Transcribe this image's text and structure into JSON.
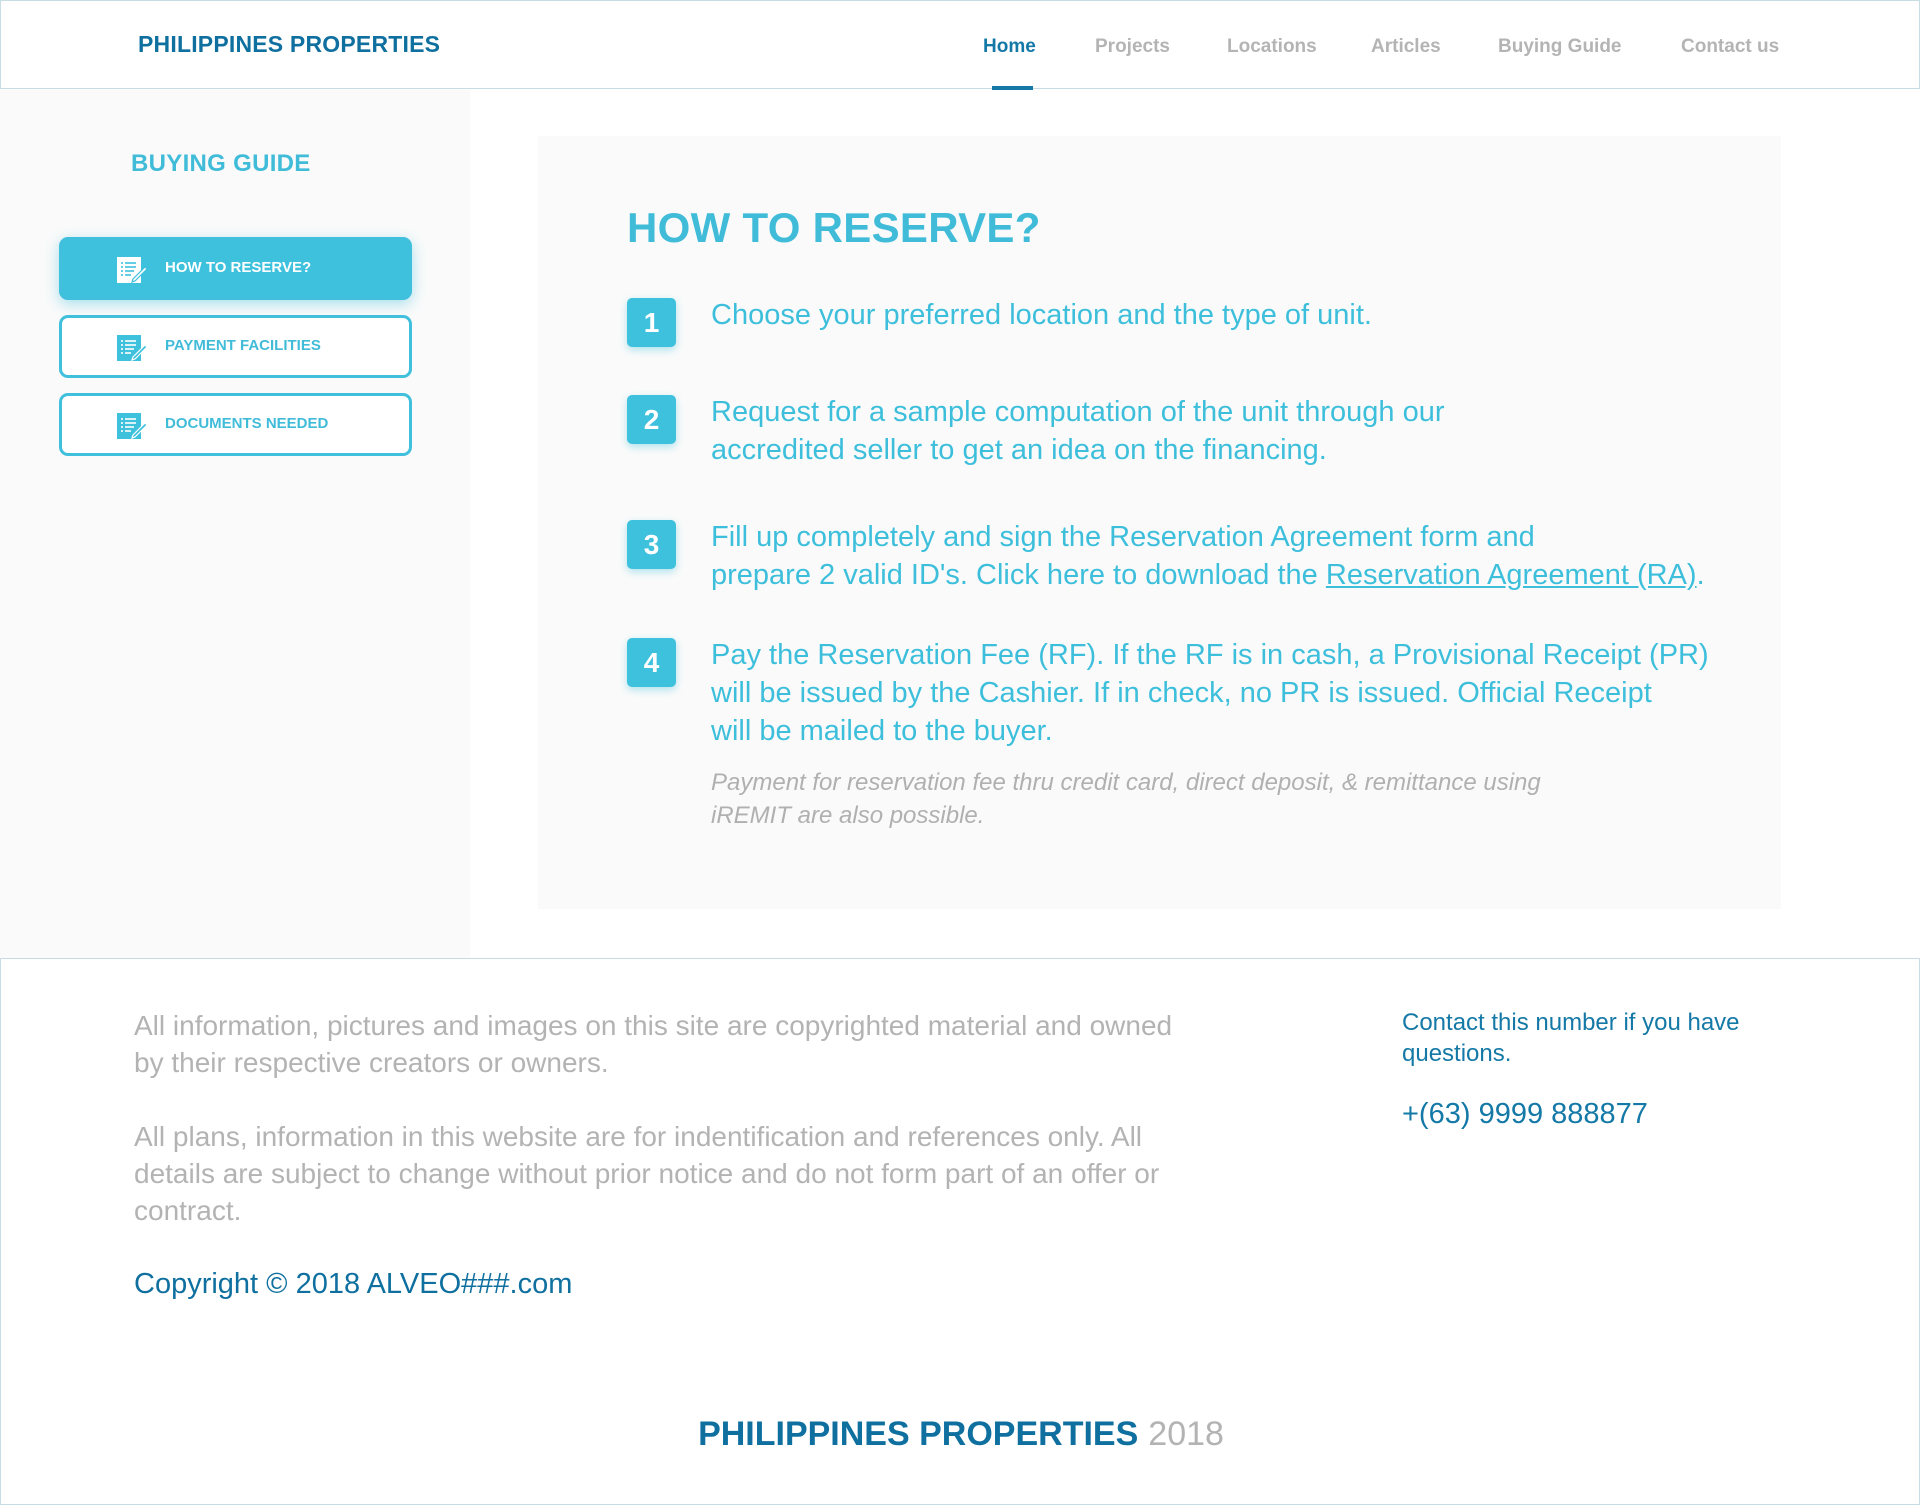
{
  "header": {
    "brand": "PHILIPPINES PROPERTIES",
    "nav": [
      {
        "label": "Home",
        "active": true
      },
      {
        "label": "Projects"
      },
      {
        "label": "Locations"
      },
      {
        "label": "Articles"
      },
      {
        "label": "Buying Guide"
      },
      {
        "label": "Contact us"
      }
    ]
  },
  "sidebar": {
    "title": "BUYING GUIDE",
    "items": [
      {
        "label": "HOW TO RESERVE?",
        "icon": "document-edit-icon",
        "active": true
      },
      {
        "label": "PAYMENT FACILITIES",
        "icon": "document-edit-icon"
      },
      {
        "label": "DOCUMENTS NEEDED",
        "icon": "document-edit-icon"
      }
    ]
  },
  "main": {
    "title": "HOW TO RESERVE?",
    "steps": [
      {
        "number": "1",
        "text": "Choose your preferred location and the type of unit."
      },
      {
        "number": "2",
        "line1": "Request for a sample computation of the unit through our",
        "line2": "accredited seller to get an idea on the financing."
      },
      {
        "number": "3",
        "line1": "Fill up completely and sign the Reservation Agreement form and",
        "line2_prefix": "prepare 2 valid ID's. Click here to download the ",
        "link": "Reservation Agreement (RA)",
        "line2_suffix": "."
      },
      {
        "number": "4",
        "line1": "Pay the Reservation Fee (RF). If the RF is in cash, a Provisional Receipt (PR)",
        "line2": "will be issued by the Cashier. If in check, no PR is issued. Official Receipt",
        "line3": "will be mailed to the buyer."
      }
    ],
    "note_line1": "Payment for reservation fee thru credit card, direct deposit, & remittance using",
    "note_line2": "iREMIT are also possible."
  },
  "footer": {
    "para1_line1": "All information, pictures and images on this site are copyrighted material and owned",
    "para1_line2": "by their respective creators or owners.",
    "para2_line1": "All plans, information in this website are for indentification and references only. All",
    "para2_line2": "details are subject to change without prior notice and do not form part of an offer or",
    "para2_line3": "contract.",
    "copyright": "Copyright © 2018 ALVEO###.com",
    "contact_line1": "Contact this number if you have",
    "contact_line2": "questions.",
    "phone": "+(63) 9999 888877",
    "brand_name": "PHILIPPINES PROPERTIES",
    "brand_year": "2018"
  },
  "colors": {
    "accent": "#3ec1dd",
    "brand": "#0f70a0",
    "muted": "#b3b3b3"
  }
}
